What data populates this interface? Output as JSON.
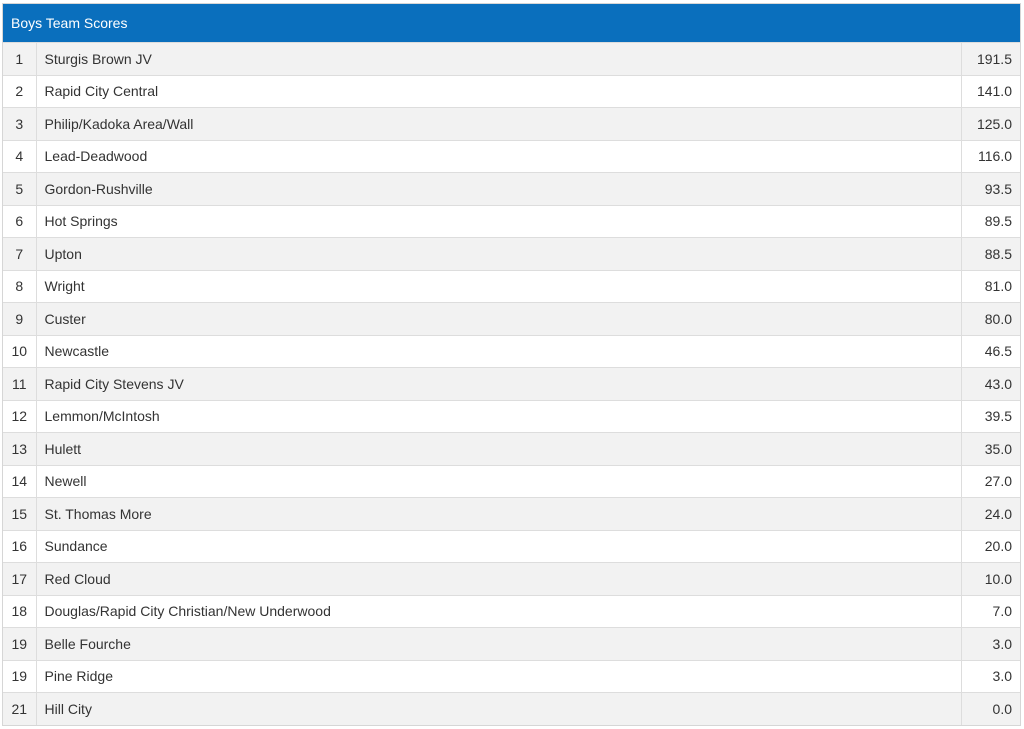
{
  "header": {
    "title": "Boys Team Scores"
  },
  "rows": [
    {
      "rank": "1",
      "team": "Sturgis Brown JV",
      "score": "191.5"
    },
    {
      "rank": "2",
      "team": "Rapid City Central",
      "score": "141.0"
    },
    {
      "rank": "3",
      "team": "Philip/Kadoka Area/Wall",
      "score": "125.0"
    },
    {
      "rank": "4",
      "team": "Lead-Deadwood",
      "score": "116.0"
    },
    {
      "rank": "5",
      "team": "Gordon-Rushville",
      "score": "93.5"
    },
    {
      "rank": "6",
      "team": "Hot Springs",
      "score": "89.5"
    },
    {
      "rank": "7",
      "team": "Upton",
      "score": "88.5"
    },
    {
      "rank": "8",
      "team": "Wright",
      "score": "81.0"
    },
    {
      "rank": "9",
      "team": "Custer",
      "score": "80.0"
    },
    {
      "rank": "10",
      "team": "Newcastle",
      "score": "46.5"
    },
    {
      "rank": "11",
      "team": "Rapid City Stevens JV",
      "score": "43.0"
    },
    {
      "rank": "12",
      "team": "Lemmon/McIntosh",
      "score": "39.5"
    },
    {
      "rank": "13",
      "team": "Hulett",
      "score": "35.0"
    },
    {
      "rank": "14",
      "team": "Newell",
      "score": "27.0"
    },
    {
      "rank": "15",
      "team": "St. Thomas More",
      "score": "24.0"
    },
    {
      "rank": "16",
      "team": "Sundance",
      "score": "20.0"
    },
    {
      "rank": "17",
      "team": "Red Cloud",
      "score": "10.0"
    },
    {
      "rank": "18",
      "team": "Douglas/Rapid City Christian/New Underwood",
      "score": "7.0"
    },
    {
      "rank": "19",
      "team": "Belle Fourche",
      "score": "3.0"
    },
    {
      "rank": "19",
      "team": "Pine Ridge",
      "score": "3.0"
    },
    {
      "rank": "21",
      "team": "Hill City",
      "score": "0.0"
    }
  ],
  "colors": {
    "header_bg": "#0a6fbd",
    "header_text": "#ffffff",
    "row_alt_bg": "#f2f2f2",
    "row_bg": "#ffffff",
    "text": "#333333"
  }
}
